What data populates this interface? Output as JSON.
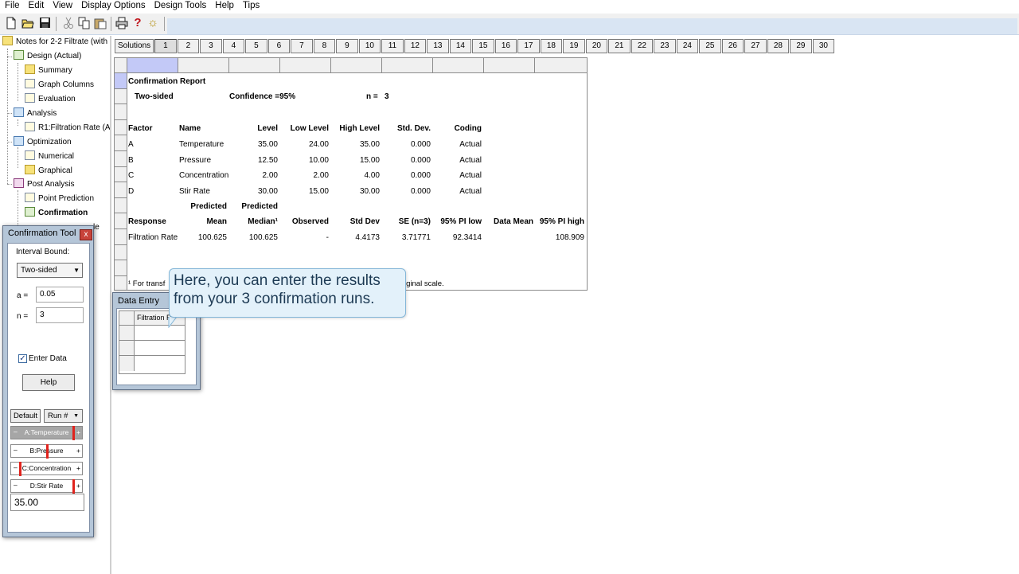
{
  "menu": [
    "File",
    "Edit",
    "View",
    "Display Options",
    "Design Tools",
    "Help",
    "Tips"
  ],
  "toolbar": {
    "icons": [
      "new-file-icon",
      "open-folder-icon",
      "save-icon",
      "cut-icon",
      "copy-icon",
      "paste-icon",
      "print-icon",
      "help-icon",
      "tips-icon"
    ],
    "help_glyph": "?",
    "tips_glyph": "☼"
  },
  "tree": {
    "root": "Notes for 2-2 Filtrate (with",
    "design": "Design (Actual)",
    "summary": "Summary",
    "graph_columns": "Graph Columns",
    "evaluation": "Evaluation",
    "analysis": "Analysis",
    "r1": "R1:Filtration Rate (A",
    "optimization": "Optimization",
    "numerical": "Numerical",
    "graphical": "Graphical",
    "post_analysis": "Post Analysis",
    "point_prediction": "Point Prediction",
    "confirmation": "Confirmation",
    "coef_partial": "le"
  },
  "solutions": {
    "label": "Solutions",
    "tabs": [
      "1",
      "2",
      "3",
      "4",
      "5",
      "6",
      "7",
      "8",
      "9",
      "10",
      "11",
      "12",
      "13",
      "14",
      "15",
      "16",
      "17",
      "18",
      "19",
      "20",
      "21",
      "22",
      "23",
      "24",
      "25",
      "26",
      "27",
      "28",
      "29",
      "30"
    ],
    "active": "1"
  },
  "report": {
    "title": "Confirmation Report",
    "sided": "Two-sided",
    "confidence": "Confidence =95%",
    "n_label": "n =",
    "n_value": "3",
    "factor_headers": [
      "Factor",
      "Name",
      "Level",
      "Low Level",
      "High Level",
      "Std. Dev.",
      "Coding"
    ],
    "factors": [
      [
        "A",
        "Temperature",
        "35.00",
        "24.00",
        "35.00",
        "0.000",
        "Actual"
      ],
      [
        "B",
        "Pressure",
        "12.50",
        "10.00",
        "15.00",
        "0.000",
        "Actual"
      ],
      [
        "C",
        "Concentration",
        "2.00",
        "2.00",
        "4.00",
        "0.000",
        "Actual"
      ],
      [
        "D",
        "Stir Rate",
        "30.00",
        "15.00",
        "30.00",
        "0.000",
        "Actual"
      ]
    ],
    "predicted_top": [
      "Predicted",
      "Predicted"
    ],
    "response_headers": [
      "Response",
      "Mean",
      "Median¹",
      "Observed",
      "Std Dev",
      "SE (n=3)",
      "95% PI low",
      "Data Mean",
      "95% PI high"
    ],
    "response_row": [
      "Filtration Rate",
      "100.625",
      "100.625",
      "-",
      "4.4173",
      "3.71771",
      "92.3414",
      "",
      "108.909"
    ],
    "footnote_left": "¹ For transf",
    "footnote_right": "iginal scale."
  },
  "confirmation_tool": {
    "title": "Confirmation Tool",
    "close_glyph": "x",
    "interval_label": "Interval Bound:",
    "interval_value": "Two-sided",
    "alpha_label": "a =",
    "alpha_value": "0.05",
    "n_label": "n =",
    "n_value": "3",
    "enter_data_label": "Enter Data",
    "enter_data_checked": true,
    "help_button": "Help"
  },
  "factor_panel": {
    "default_button": "Default",
    "run_button": "Run #",
    "sliders": [
      {
        "label": "A:Temperature",
        "level": 1.0,
        "highlighted": true
      },
      {
        "label": "B:Pressure",
        "level": 0.5,
        "highlighted": false
      },
      {
        "label": "C:Concentration",
        "level": 0.0,
        "highlighted": false
      },
      {
        "label": "D:Stir Rate",
        "level": 1.0,
        "highlighted": false
      }
    ],
    "value": "35.00"
  },
  "data_entry": {
    "title": "Data Entry",
    "column_header": "Filtration R"
  },
  "callout": {
    "line1": "Here, you can enter the results",
    "line2": "from your 3 confirmation runs."
  },
  "colors": {
    "selection": "#c3c9f7",
    "window_frame": "#b5c6d8",
    "callout_bg": "#e3f1fa",
    "slider_marker": "#e0231d"
  }
}
